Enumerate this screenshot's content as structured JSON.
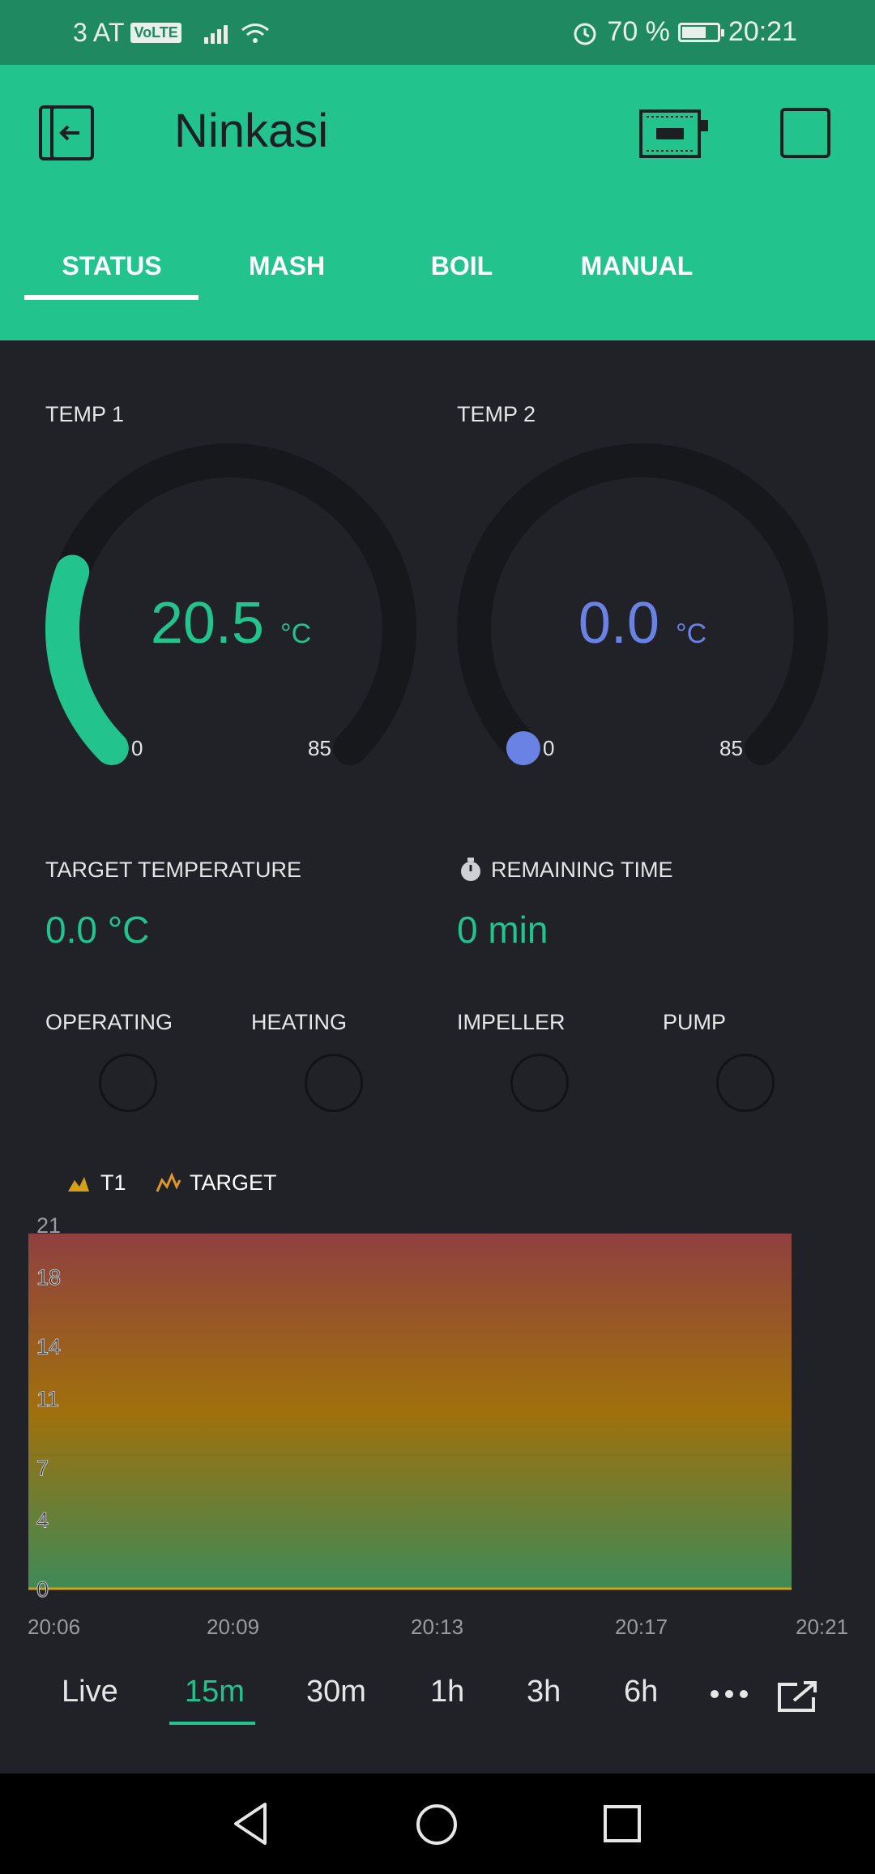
{
  "status_bar": {
    "carrier": "3 AT",
    "volte": "VoLTE",
    "battery_percent": "70 %",
    "battery_level": 0.7,
    "time": "20:21"
  },
  "header": {
    "title": "Ninkasi"
  },
  "tabs": [
    {
      "label": "STATUS",
      "active": true
    },
    {
      "label": "MASH"
    },
    {
      "label": "BOIL"
    },
    {
      "label": "MANUAL"
    }
  ],
  "gauges": [
    {
      "label": "TEMP 1",
      "value": "20.5",
      "unit": "°C",
      "min": "0",
      "max": "85",
      "color": "#23c38d",
      "level": 0.24
    },
    {
      "label": "TEMP 2",
      "value": "0.0",
      "unit": "°C",
      "min": "0",
      "max": "85",
      "color": "#6a82e3",
      "level": 0.0
    }
  ],
  "target": {
    "label": "TARGET TEMPERATURE",
    "value": "0.0 °C"
  },
  "remaining": {
    "label": "REMAINING TIME",
    "value": "0 min"
  },
  "indicators": [
    {
      "label": "OPERATING"
    },
    {
      "label": "HEATING"
    },
    {
      "label": "IMPELLER"
    },
    {
      "label": "PUMP"
    }
  ],
  "chart_data": {
    "type": "area",
    "legend": [
      "T1",
      "TARGET"
    ],
    "y_ticks": [
      "21",
      "18",
      "14",
      "11",
      "7",
      "4",
      "0"
    ],
    "x_ticks": [
      "20:06",
      "20:09",
      "20:13",
      "20:17",
      "20:21"
    ],
    "ylim": [
      0,
      21
    ],
    "series": [
      {
        "name": "T1",
        "x": [
          "20:06",
          "20:09",
          "20:13",
          "20:17",
          "20:21"
        ],
        "values": [
          20.5,
          20.5,
          20.5,
          20.5,
          20.5
        ]
      },
      {
        "name": "TARGET",
        "x": [
          "20:06",
          "20:09",
          "20:13",
          "20:17",
          "20:21"
        ],
        "values": [
          0,
          0,
          0,
          0,
          0
        ]
      }
    ]
  },
  "ranges": [
    {
      "label": "Live"
    },
    {
      "label": "15m",
      "active": true
    },
    {
      "label": "30m"
    },
    {
      "label": "1h"
    },
    {
      "label": "3h"
    },
    {
      "label": "6h"
    }
  ],
  "icons": {
    "exit": "exit-icon",
    "device": "device-icon",
    "more": "more-icon",
    "export": "export-icon",
    "back": "back-icon",
    "home": "home-icon",
    "recents": "recents-icon"
  }
}
